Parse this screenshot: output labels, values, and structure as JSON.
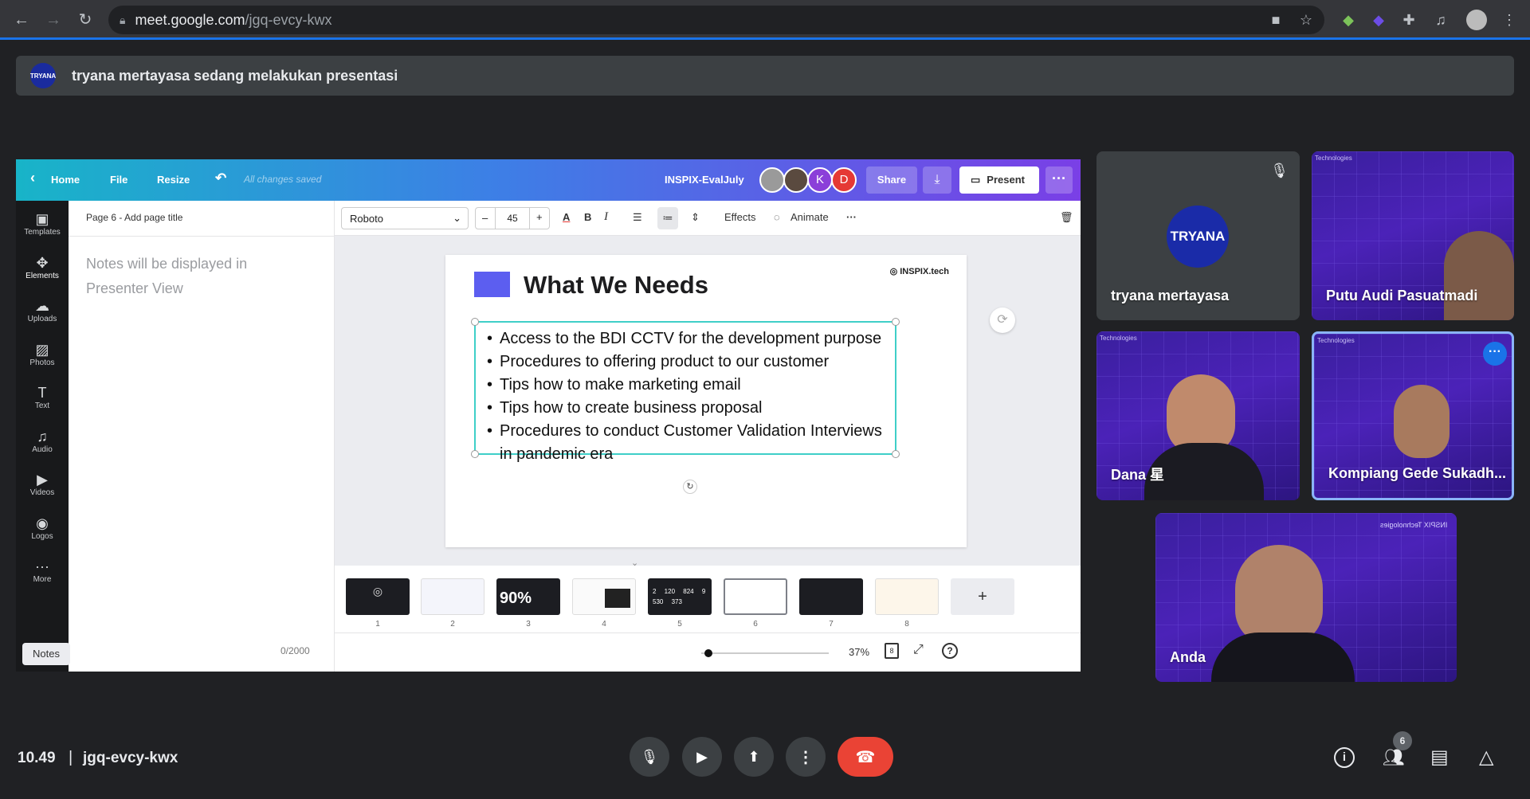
{
  "browser": {
    "url_domain": "meet.google.com",
    "url_path": "/jgq-evcy-kwx"
  },
  "banner": {
    "logo_text": "TRYANA",
    "text": "tryana mertayasa sedang melakukan presentasi"
  },
  "canva": {
    "topbar": {
      "home": "Home",
      "file": "File",
      "resize": "Resize",
      "saved": "All changes saved",
      "doc_title": "INSPIX-EvalJuly",
      "avatar_k": "K",
      "avatar_d": "D",
      "share": "Share",
      "present": "Present"
    },
    "sidebar": [
      {
        "label": "Templates",
        "icon": "templates-icon"
      },
      {
        "label": "Elements",
        "icon": "elements-icon"
      },
      {
        "label": "Uploads",
        "icon": "uploads-icon"
      },
      {
        "label": "Photos",
        "icon": "photos-icon"
      },
      {
        "label": "Text",
        "icon": "text-icon"
      },
      {
        "label": "Audio",
        "icon": "audio-icon"
      },
      {
        "label": "Videos",
        "icon": "videos-icon"
      },
      {
        "label": "Logos",
        "icon": "logos-icon"
      },
      {
        "label": "More",
        "icon": "more-icon"
      }
    ],
    "notes": {
      "page_title": "Page 6 - Add page title",
      "placeholder": "Notes will be displayed in Presenter View",
      "counter": "0/2000",
      "tab": "Notes"
    },
    "toolbar": {
      "font": "Roboto",
      "minus": "–",
      "size": "45",
      "plus": "+",
      "effects": "Effects",
      "animate": "Animate"
    },
    "slide": {
      "title": "What We Needs",
      "brand": "INSPIX.tech",
      "bullets": [
        "Access to the BDI CCTV for the development purpose",
        "Procedures to offering product to our customer",
        "Tips how to make marketing email",
        "Tips how to create business proposal",
        "Procedures to conduct Customer Validation Interviews in pandemic era"
      ]
    },
    "thumbnails": [
      {
        "num": "1",
        "text": ""
      },
      {
        "num": "2",
        "text": ""
      },
      {
        "num": "3",
        "text": "90%"
      },
      {
        "num": "4",
        "text": ""
      },
      {
        "num": "5",
        "text": "2 120 824 9 530 373"
      },
      {
        "num": "6",
        "text": ""
      },
      {
        "num": "7",
        "text": ""
      },
      {
        "num": "8",
        "text": ""
      }
    ],
    "zoom": "37%",
    "page_count": "8",
    "help": "?"
  },
  "participants": {
    "tryana": {
      "name": "tryana mertayasa",
      "logo": "TRYANA"
    },
    "putu": {
      "name": "Putu Audi Pasuatmadi",
      "tag": "Technologies"
    },
    "dana": {
      "name": "Dana 星",
      "tag": "Technologies"
    },
    "kompiang": {
      "name": "Kompiang Gede Sukadh...",
      "tag": "Technologies"
    },
    "anda": {
      "name": "Anda",
      "tag": "INSPIX Technologies"
    }
  },
  "meet": {
    "time": "10.49",
    "separator": "|",
    "code": "jgq-evcy-kwx",
    "people_count": "6"
  },
  "colors": {
    "meet_bg": "#202124",
    "end_call": "#ea4335",
    "accent_blue": "#1a73e8",
    "slide_square": "#5c5ef0",
    "textbox_border": "#3fcfc8"
  }
}
